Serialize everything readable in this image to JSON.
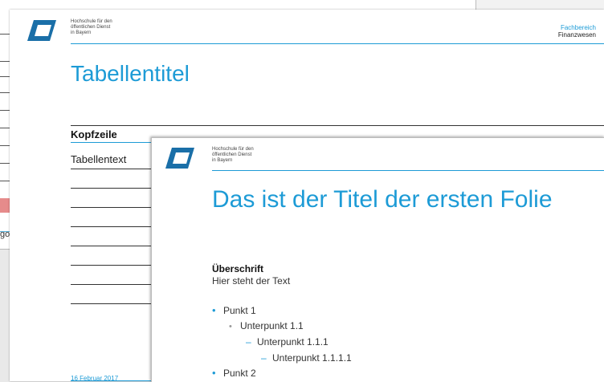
{
  "background_window": {
    "fragment_text": "go"
  },
  "slide_back": {
    "org_name": [
      "Hochschule für den",
      "öffentlichen Dienst",
      "in Bayern"
    ],
    "department": [
      "Fachbereich",
      "Finanzwesen"
    ],
    "title": "Tabellentitel",
    "table": {
      "header_visible": "Kopfzeile",
      "cell_visible": "Tabellentext"
    },
    "date": "16 Februar 2017"
  },
  "slide_front": {
    "org_name": [
      "Hochschule für den",
      "öffentlichen Dienst",
      "in Bayern"
    ],
    "title": "Das ist der Titel der ersten Folie",
    "heading": "Überschrift",
    "text": "Hier steht der Text",
    "bullets": [
      {
        "level": 1,
        "text": "Punkt 1"
      },
      {
        "level": 2,
        "text": "Unterpunkt 1.1"
      },
      {
        "level": 3,
        "text": "Unterpunkt 1.1.1"
      },
      {
        "level": 4,
        "text": "Unterpunkt 1.1.1.1"
      },
      {
        "level": 1,
        "text": "Punkt 2"
      }
    ]
  },
  "colors": {
    "accent": "#1d9bd6",
    "logo_dark": "#1a6fa8"
  }
}
